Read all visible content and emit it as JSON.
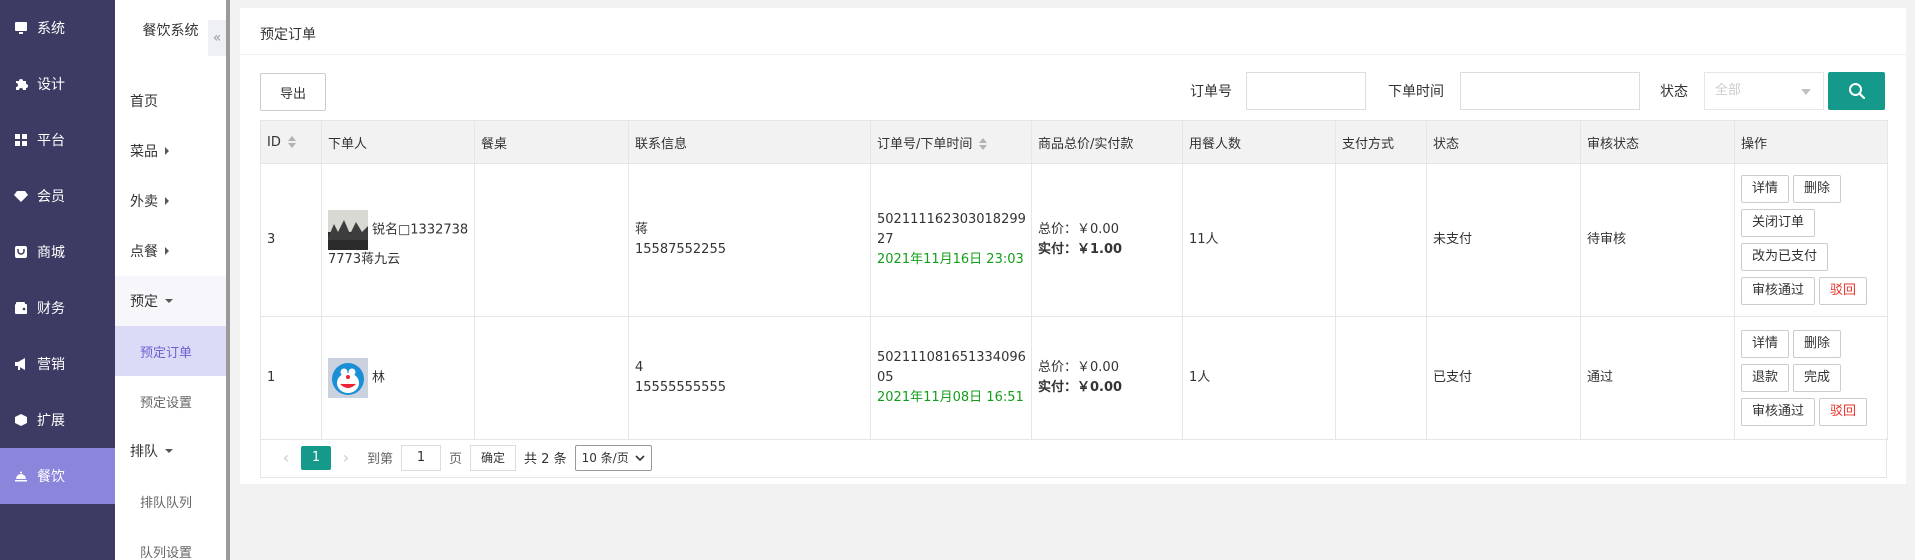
{
  "nav1": {
    "items": [
      {
        "label": "系统",
        "icon": "monitor-icon"
      },
      {
        "label": "设计",
        "icon": "puzzle-icon"
      },
      {
        "label": "平台",
        "icon": "grid-icon"
      },
      {
        "label": "会员",
        "icon": "gem-icon"
      },
      {
        "label": "商城",
        "icon": "shop-icon"
      },
      {
        "label": "财务",
        "icon": "wallet-icon"
      },
      {
        "label": "营销",
        "icon": "megaphone-icon"
      },
      {
        "label": "扩展",
        "icon": "cube-icon"
      },
      {
        "label": "餐饮",
        "icon": "cloche-icon",
        "active": true
      }
    ]
  },
  "nav2": {
    "title": "餐饮系统",
    "collapse": "«",
    "home": "首页",
    "dishes": "菜品",
    "takeout": "外卖",
    "order_food": "点餐",
    "reserve": "预定",
    "reserve_orders": "预定订单",
    "reserve_settings": "预定设置",
    "queue": "排队",
    "queue_list": "排队队列",
    "queue_settings": "队列设置"
  },
  "card": {
    "title": "预定订单",
    "export_label": "导出"
  },
  "filters": {
    "order_no_label": "订单号",
    "order_no_value": "",
    "time_label": "下单时间",
    "time_value": "",
    "status_label": "状态",
    "status_value": "全部"
  },
  "table": {
    "headers": [
      "ID",
      "下单人",
      "餐桌",
      "联系信息",
      "订单号/下单时间",
      "商品总价/实付款",
      "用餐人数",
      "支付方式",
      "状态",
      "审核状态",
      "操作"
    ],
    "rows": [
      {
        "id": "3",
        "customer": "锐名□1332738 7773蒋九云",
        "table": "",
        "contact_name": "蒋",
        "contact_phone": "15587552255",
        "order_no": "50211116230301829927",
        "order_time": "2021年11月16日 23:03",
        "total_label": "总价：",
        "total": "￥0.00",
        "paid_label": "实付：",
        "paid": "￥1.00",
        "diners": "11人",
        "pay_method": "",
        "status": "未支付",
        "audit": "待审核",
        "actions": [
          "详情",
          "删除",
          "关闭订单",
          "改为已支付",
          "审核通过",
          "驳回"
        ]
      },
      {
        "id": "1",
        "customer": "林",
        "table": "",
        "contact_name": "4",
        "contact_phone": "15555555555",
        "order_no": "50211108165133409605",
        "order_time": "2021年11月08日 16:51",
        "total_label": "总价：",
        "total": "￥0.00",
        "paid_label": "实付：",
        "paid": "￥0.00",
        "diners": "1人",
        "pay_method": "",
        "status": "已支付",
        "audit": "通过",
        "actions": [
          "详情",
          "删除",
          "退款",
          "完成",
          "审核通过",
          "驳回"
        ]
      }
    ]
  },
  "pager": {
    "prev": "‹",
    "current": "1",
    "next": "›",
    "goto_label": "到第",
    "goto_value": "1",
    "page_unit": "页",
    "confirm": "确定",
    "total": "共 2 条",
    "page_size": "10 条/页"
  },
  "colors": {
    "nav_bg": "#3c3b63",
    "nav_active": "#8b85dc",
    "primary": "#14998a",
    "green": "#139e1a",
    "orange": "#f58a4c",
    "red": "#e8312a"
  }
}
